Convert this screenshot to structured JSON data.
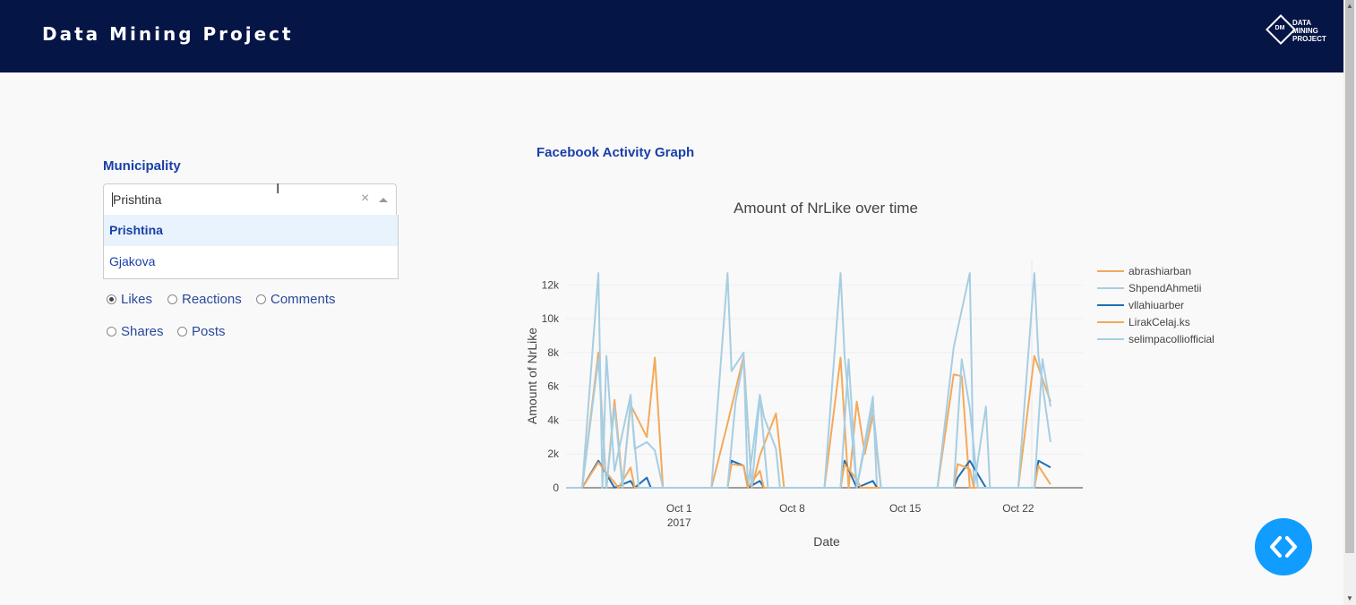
{
  "header": {
    "title": "Data Mining Project",
    "logo": {
      "mark": "DM",
      "lines": [
        "DATA",
        "MINING",
        "PROJECT"
      ]
    }
  },
  "filters": {
    "municipality_label": "Municipality",
    "select_value": "Prishtina",
    "options": [
      "Prishtina",
      "Gjakova"
    ],
    "selected_option": "Prishtina",
    "metrics": [
      {
        "label": "Likes",
        "checked": true
      },
      {
        "label": "Reactions",
        "checked": false
      },
      {
        "label": "Comments",
        "checked": false
      },
      {
        "label": "Shares",
        "checked": false
      },
      {
        "label": "Posts",
        "checked": false
      }
    ]
  },
  "graph_section_title": "Facebook Activity Graph",
  "chart_data": {
    "type": "line",
    "title": "Amount of NrLike over time",
    "xlabel": "Date",
    "ylabel": "Amount of NrLike",
    "ylim": [
      0,
      13500
    ],
    "yticks": [
      {
        "value": 0,
        "label": "0"
      },
      {
        "value": 2000,
        "label": "2k"
      },
      {
        "value": 4000,
        "label": "4k"
      },
      {
        "value": 6000,
        "label": "6k"
      },
      {
        "value": 8000,
        "label": "8k"
      },
      {
        "value": 10000,
        "label": "10k"
      },
      {
        "value": 12000,
        "label": "12k"
      }
    ],
    "xlim": [
      "2017-09-24",
      "2017-10-26"
    ],
    "xticks": [
      {
        "date": "2017-10-01",
        "label": "Oct 1",
        "sublabel": "2017"
      },
      {
        "date": "2017-10-08",
        "label": "Oct 8",
        "sublabel": ""
      },
      {
        "date": "2017-10-15",
        "label": "Oct 15",
        "sublabel": ""
      },
      {
        "date": "2017-10-22",
        "label": "Oct 22",
        "sublabel": ""
      }
    ],
    "legend_position": "right",
    "series": [
      {
        "name": "abrashiarban",
        "color": "#f4a95a",
        "points": [
          [
            "2017-09-24",
            0
          ],
          [
            "2017-09-25",
            0
          ],
          [
            "2017-09-26",
            8000
          ],
          [
            "2017-09-26T12:00",
            0
          ],
          [
            "2017-09-27",
            5200
          ],
          [
            "2017-09-27T12:00",
            200
          ],
          [
            "2017-09-28",
            4900
          ],
          [
            "2017-09-29",
            3000
          ],
          [
            "2017-09-29T12:00",
            7700
          ],
          [
            "2017-09-30",
            0
          ],
          [
            "2017-10-01",
            0
          ],
          [
            "2017-10-03",
            0
          ],
          [
            "2017-10-04",
            3800
          ],
          [
            "2017-10-05",
            7800
          ],
          [
            "2017-10-05T12:00",
            0
          ],
          [
            "2017-10-06",
            1900
          ],
          [
            "2017-10-07",
            4400
          ],
          [
            "2017-10-07T12:00",
            0
          ],
          [
            "2017-10-10",
            0
          ],
          [
            "2017-10-11",
            7700
          ],
          [
            "2017-10-11T12:00",
            0
          ],
          [
            "2017-10-12",
            5100
          ],
          [
            "2017-10-12T12:00",
            2000
          ],
          [
            "2017-10-13",
            4300
          ],
          [
            "2017-10-13T12:00",
            0
          ],
          [
            "2017-10-17",
            0
          ],
          [
            "2017-10-18",
            6700
          ],
          [
            "2017-10-18T12:00",
            6600
          ],
          [
            "2017-10-19",
            0
          ],
          [
            "2017-10-22",
            0
          ],
          [
            "2017-10-23",
            7800
          ],
          [
            "2017-10-24",
            5100
          ]
        ]
      },
      {
        "name": "ShpendAhmetii",
        "color": "#a6cee3",
        "points": [
          [
            "2017-09-24",
            0
          ],
          [
            "2017-09-25",
            0
          ],
          [
            "2017-09-26",
            12700
          ],
          [
            "2017-09-26T06:00",
            0
          ],
          [
            "2017-09-26T12:00",
            7800
          ],
          [
            "2017-09-27",
            1000
          ],
          [
            "2017-09-28",
            5500
          ],
          [
            "2017-09-28T06:00",
            2300
          ],
          [
            "2017-09-29",
            2700
          ],
          [
            "2017-09-29T12:00",
            2200
          ],
          [
            "2017-09-30",
            0
          ],
          [
            "2017-10-03",
            0
          ],
          [
            "2017-10-04",
            12700
          ],
          [
            "2017-10-04T06:00",
            6900
          ],
          [
            "2017-10-05",
            8000
          ],
          [
            "2017-10-05T06:00",
            0
          ],
          [
            "2017-10-06",
            5500
          ],
          [
            "2017-10-06T06:00",
            4200
          ],
          [
            "2017-10-07",
            2300
          ],
          [
            "2017-10-07T06:00",
            0
          ],
          [
            "2017-10-10",
            0
          ],
          [
            "2017-10-11",
            12700
          ],
          [
            "2017-10-11T06:00",
            7800
          ],
          [
            "2017-10-12",
            0
          ],
          [
            "2017-10-13",
            5400
          ],
          [
            "2017-10-13T06:00",
            0
          ],
          [
            "2017-10-17",
            0
          ],
          [
            "2017-10-18",
            8300
          ],
          [
            "2017-10-19",
            12700
          ],
          [
            "2017-10-19T06:00",
            0
          ],
          [
            "2017-10-20",
            4800
          ],
          [
            "2017-10-20T06:00",
            0
          ],
          [
            "2017-10-22",
            0
          ],
          [
            "2017-10-23",
            12700
          ],
          [
            "2017-10-23T06:00",
            7800
          ],
          [
            "2017-10-24",
            2700
          ]
        ]
      },
      {
        "name": "vllahiuarber",
        "color": "#1f6fb4",
        "points": [
          [
            "2017-09-24",
            0
          ],
          [
            "2017-09-25",
            0
          ],
          [
            "2017-09-26",
            1600
          ],
          [
            "2017-09-27",
            0
          ],
          [
            "2017-09-28",
            400
          ],
          [
            "2017-09-28T06:00",
            0
          ],
          [
            "2017-09-29",
            600
          ],
          [
            "2017-09-29T06:00",
            0
          ],
          [
            "2017-10-04",
            0
          ],
          [
            "2017-10-04T06:00",
            1600
          ],
          [
            "2017-10-05",
            1300
          ],
          [
            "2017-10-05T06:00",
            0
          ],
          [
            "2017-10-06",
            400
          ],
          [
            "2017-10-06T06:00",
            0
          ],
          [
            "2017-10-11",
            0
          ],
          [
            "2017-10-11T06:00",
            1600
          ],
          [
            "2017-10-12",
            0
          ],
          [
            "2017-10-13",
            400
          ],
          [
            "2017-10-13T06:00",
            0
          ],
          [
            "2017-10-18",
            0
          ],
          [
            "2017-10-18T06:00",
            600
          ],
          [
            "2017-10-19",
            1600
          ],
          [
            "2017-10-20",
            0
          ],
          [
            "2017-10-23",
            0
          ],
          [
            "2017-10-23T06:00",
            1600
          ],
          [
            "2017-10-24",
            1200
          ]
        ]
      },
      {
        "name": "LirakCelaj.ks",
        "color": "#f4a95a",
        "points": [
          [
            "2017-09-24",
            0
          ],
          [
            "2017-09-25",
            0
          ],
          [
            "2017-09-26",
            1500
          ],
          [
            "2017-09-27",
            300
          ],
          [
            "2017-09-27T06:00",
            0
          ],
          [
            "2017-09-28",
            1200
          ],
          [
            "2017-09-28T06:00",
            0
          ],
          [
            "2017-10-04",
            0
          ],
          [
            "2017-10-04T06:00",
            1400
          ],
          [
            "2017-10-05",
            1300
          ],
          [
            "2017-10-05T06:00",
            0
          ],
          [
            "2017-10-06",
            1000
          ],
          [
            "2017-10-06T06:00",
            0
          ],
          [
            "2017-10-11",
            0
          ],
          [
            "2017-10-11T06:00",
            1400
          ],
          [
            "2017-10-12",
            500
          ],
          [
            "2017-10-12T06:00",
            0
          ],
          [
            "2017-10-18",
            0
          ],
          [
            "2017-10-18T06:00",
            1400
          ],
          [
            "2017-10-19",
            1100
          ],
          [
            "2017-10-19T06:00",
            0
          ],
          [
            "2017-10-23",
            0
          ],
          [
            "2017-10-23T06:00",
            1300
          ],
          [
            "2017-10-24",
            200
          ]
        ]
      },
      {
        "name": "selimpacolliofficial",
        "color": "#a6cee3",
        "points": [
          [
            "2017-09-24",
            0
          ],
          [
            "2017-09-25",
            0
          ],
          [
            "2017-09-26",
            7600
          ],
          [
            "2017-09-26T12:00",
            0
          ],
          [
            "2017-09-27",
            4800
          ],
          [
            "2017-09-27T12:00",
            0
          ],
          [
            "2017-09-28",
            5200
          ],
          [
            "2017-09-28T12:00",
            0
          ],
          [
            "2017-09-29",
            0
          ],
          [
            "2017-10-04",
            0
          ],
          [
            "2017-10-04T12:00",
            5100
          ],
          [
            "2017-10-05",
            7600
          ],
          [
            "2017-10-05T12:00",
            0
          ],
          [
            "2017-10-06",
            5400
          ],
          [
            "2017-10-06T12:00",
            0
          ],
          [
            "2017-10-11",
            0
          ],
          [
            "2017-10-11T12:00",
            7600
          ],
          [
            "2017-10-12",
            0
          ],
          [
            "2017-10-13",
            4800
          ],
          [
            "2017-10-13T12:00",
            0
          ],
          [
            "2017-10-18",
            0
          ],
          [
            "2017-10-18T12:00",
            7600
          ],
          [
            "2017-10-19",
            4700
          ],
          [
            "2017-10-19T12:00",
            0
          ],
          [
            "2017-10-23",
            0
          ],
          [
            "2017-10-23T12:00",
            7600
          ],
          [
            "2017-10-24",
            4800
          ]
        ]
      }
    ]
  }
}
